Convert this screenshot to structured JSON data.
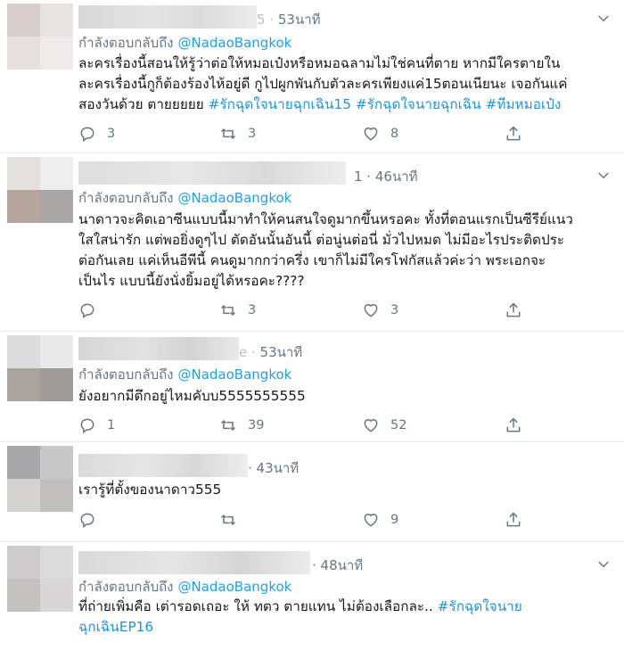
{
  "tweets": [
    {
      "time": "53นาที",
      "time_prefix": "5 · ",
      "reply_label": "กำลังตอบกลับถึง",
      "mention": "@NadaoBangkok",
      "text_plain": "ละครเรื่องนี้สอนให้รู้ว่าต่อให้หมอเป๋งหรือหมอฉลามไม่ใช่คนที่ตาย หากมีใครตายใน\nละครเรื่องนี้กูก็ต้องร้องไห้อยู่ดี กูไปผูกพันกับตัวละครเพียงแค่15ตอนเนียนะ เจอกันแค่\nสองวันด้วย ตายยยยย ",
      "hashtags": [
        "#รักฉุดใจนายฉุกเฉิน15",
        "#รักฉุดใจนายฉุกเฉิน",
        "#ทีมหมอเป๋ง"
      ],
      "replies": "3",
      "retweets": "3",
      "likes": "8"
    },
    {
      "time": "46นาที",
      "time_prefix": "1 · ",
      "reply_label": "กำลังตอบกลับถึง",
      "mention": "@NadaoBangkok",
      "text_plain": "นาดาวจะคิดเอาซีนแบบนี้มาทำให้คนสนใจดูมากขึ้นหรอคะ ทั้งที่ตอนแรกเป็นซีรีย์แนว\nใสใสน่ารัก แต่พอยิ่งดูๆไป ตัดอันนั้นอันนี้ ต่อนู่นต่อนี่ มั่วไปหมด ไม่มีอะไรประติดประ\nต่อกันเลย แค่เห็นอีพีนี้ คนดูมากกว่าครึ่ง เขาก็ไม่มีใครโฟกัสแล้วค่ะว่า พระเอกจะ\nเป็นไร แบบนี้ยังนั่งยิ้มอยู่ได้หรอคะ????",
      "replies": "",
      "retweets": "3",
      "likes": "3"
    },
    {
      "time": "53นาที",
      "time_prefix": "e · ",
      "reply_label": "กำลังตอบกลับถึง",
      "mention": "@NadaoBangkok",
      "text_plain": "ยังอยากมีตึกอยู่ไหมคับบ5555555555",
      "replies": "1",
      "retweets": "39",
      "likes": "52"
    },
    {
      "time": "43นาที",
      "time_prefix": "· ",
      "text_plain": "เรารู้ที่ตั้งของนาดาว555",
      "replies": "",
      "retweets": "",
      "likes": "9"
    },
    {
      "time": "48นาที",
      "time_prefix": "· ",
      "reply_label": "กำลังตอบกลับถึง",
      "mention": "@NadaoBangkok",
      "text_plain": "ที่ถ่ายเพิ่มคือ เต่ารอดเถอะ ให้ ทตว ตายแทน ไม่ต้องเลือกละ.. ",
      "hashtags": [
        "#รักฉุดใจนาย\nฉุกเฉินEP16"
      ]
    }
  ],
  "colors": {
    "text": "#14171a",
    "muted": "#657786",
    "link": "#1da1f2",
    "hashtag": "#1b95e0",
    "border": "#e6ecf0"
  },
  "icons": [
    "reply-icon",
    "retweet-icon",
    "like-icon",
    "share-icon",
    "chevron-down-icon"
  ]
}
